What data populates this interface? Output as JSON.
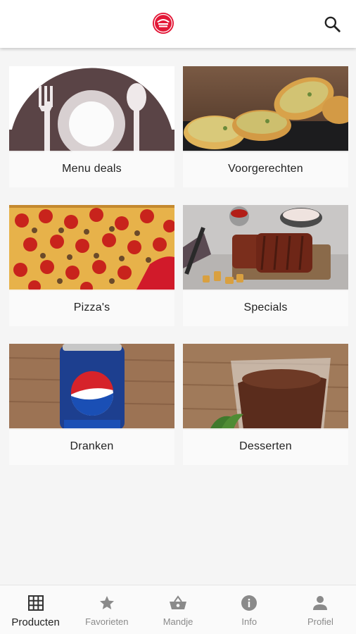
{
  "header": {
    "logo_icon": "pizza-hut-logo",
    "search_icon": "search-icon",
    "brand_color": "#e31837"
  },
  "categories": [
    {
      "label": "Menu deals",
      "image": "plate-fork-spoon"
    },
    {
      "label": "Voorgerechten",
      "image": "garlic-bread"
    },
    {
      "label": "Pizza's",
      "image": "pepperoni-pizza"
    },
    {
      "label": "Specials",
      "image": "ribs-plate"
    },
    {
      "label": "Dranken",
      "image": "pepsi-can"
    },
    {
      "label": "Desserten",
      "image": "chocolate-mousse"
    }
  ],
  "bottom_nav": {
    "items": [
      {
        "label": "Producten",
        "icon": "grid-icon",
        "active": true
      },
      {
        "label": "Favorieten",
        "icon": "star-icon",
        "active": false
      },
      {
        "label": "Mandje",
        "icon": "basket-icon",
        "active": false
      },
      {
        "label": "Info",
        "icon": "info-icon",
        "active": false
      },
      {
        "label": "Profiel",
        "icon": "person-icon",
        "active": false
      }
    ]
  }
}
